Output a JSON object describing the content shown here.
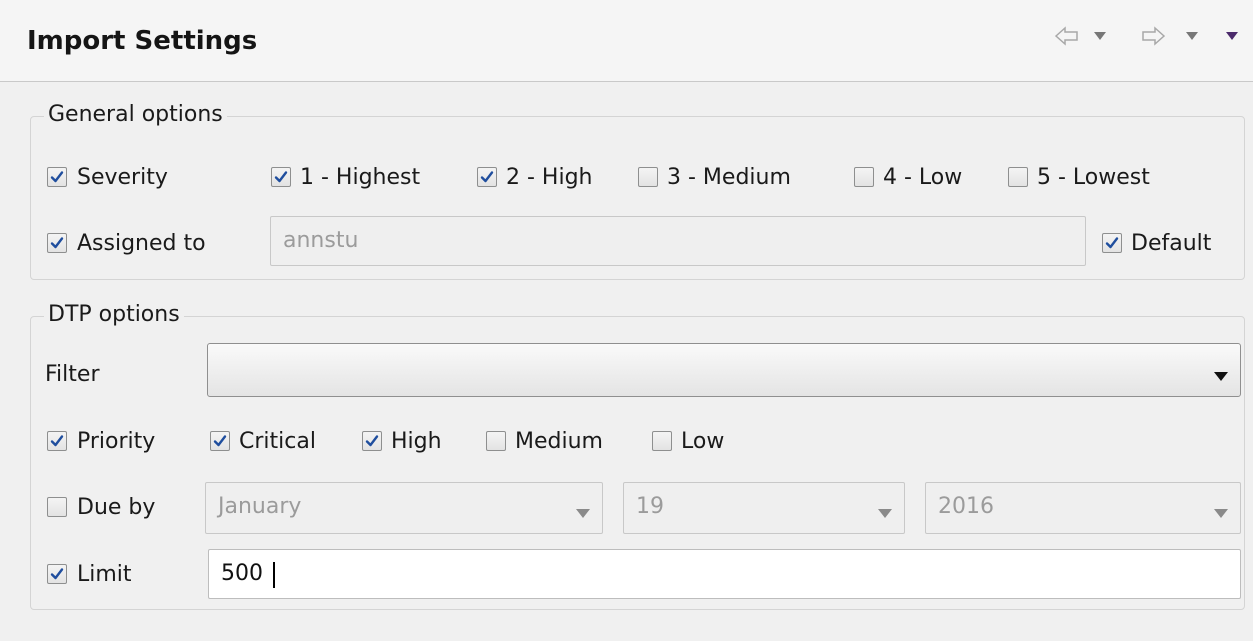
{
  "header": {
    "title": "Import Settings"
  },
  "general": {
    "legend": "General options",
    "severity": {
      "label": "Severity",
      "checked": true,
      "options": [
        {
          "label": "1 - Highest",
          "checked": true
        },
        {
          "label": "2 - High",
          "checked": true
        },
        {
          "label": "3 - Medium",
          "checked": false
        },
        {
          "label": "4 - Low",
          "checked": false
        },
        {
          "label": "5 - Lowest",
          "checked": false
        }
      ]
    },
    "assigned": {
      "label": "Assigned to",
      "checked": true,
      "value": "annstu",
      "default_label": "Default",
      "default_checked": true
    }
  },
  "dtp": {
    "legend": "DTP options",
    "filter": {
      "label": "Filter",
      "value": ""
    },
    "priority": {
      "label": "Priority",
      "checked": true,
      "options": [
        {
          "label": "Critical",
          "checked": true
        },
        {
          "label": "High",
          "checked": true
        },
        {
          "label": "Medium",
          "checked": false
        },
        {
          "label": "Low",
          "checked": false
        }
      ]
    },
    "due": {
      "label": "Due by",
      "checked": false,
      "month": "January",
      "day": "19",
      "year": "2016"
    },
    "limit": {
      "label": "Limit",
      "checked": true,
      "value": "500"
    }
  },
  "icons": [
    "back-arrow-icon",
    "forward-arrow-icon",
    "chevron-down-icon",
    "view-menu-icon"
  ],
  "colors": {
    "check": "#1f4e9e",
    "disabled_text": "#9b9b9b",
    "background": "#f0f0f0"
  }
}
